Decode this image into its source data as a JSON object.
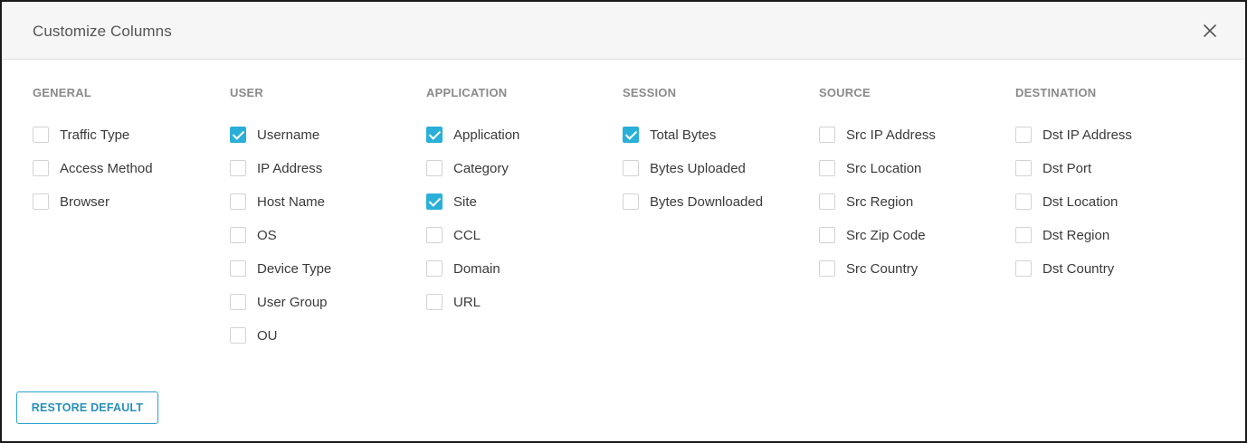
{
  "dialog": {
    "title": "Customize Columns",
    "close_icon": "close-icon"
  },
  "accent_color": "#2ab0d8",
  "groups": [
    {
      "id": "general",
      "heading": "GENERAL",
      "options": [
        {
          "label": "Traffic Type",
          "checked": false
        },
        {
          "label": "Access Method",
          "checked": false
        },
        {
          "label": "Browser",
          "checked": false
        }
      ]
    },
    {
      "id": "user",
      "heading": "USER",
      "options": [
        {
          "label": "Username",
          "checked": true
        },
        {
          "label": "IP Address",
          "checked": false
        },
        {
          "label": "Host Name",
          "checked": false
        },
        {
          "label": "OS",
          "checked": false
        },
        {
          "label": "Device Type",
          "checked": false
        },
        {
          "label": "User Group",
          "checked": false
        },
        {
          "label": "OU",
          "checked": false
        }
      ]
    },
    {
      "id": "application",
      "heading": "APPLICATION",
      "options": [
        {
          "label": "Application",
          "checked": true
        },
        {
          "label": "Category",
          "checked": false
        },
        {
          "label": "Site",
          "checked": true
        },
        {
          "label": "CCL",
          "checked": false
        },
        {
          "label": "Domain",
          "checked": false
        },
        {
          "label": "URL",
          "checked": false
        }
      ]
    },
    {
      "id": "session",
      "heading": "SESSION",
      "options": [
        {
          "label": "Total Bytes",
          "checked": true
        },
        {
          "label": "Bytes Uploaded",
          "checked": false
        },
        {
          "label": "Bytes Downloaded",
          "checked": false
        }
      ]
    },
    {
      "id": "source",
      "heading": "SOURCE",
      "options": [
        {
          "label": "Src IP Address",
          "checked": false
        },
        {
          "label": "Src Location",
          "checked": false
        },
        {
          "label": "Src Region",
          "checked": false
        },
        {
          "label": "Src Zip Code",
          "checked": false
        },
        {
          "label": "Src Country",
          "checked": false
        }
      ]
    },
    {
      "id": "destination",
      "heading": "DESTINATION",
      "options": [
        {
          "label": "Dst IP Address",
          "checked": false
        },
        {
          "label": "Dst Port",
          "checked": false
        },
        {
          "label": "Dst Location",
          "checked": false
        },
        {
          "label": "Dst Region",
          "checked": false
        },
        {
          "label": "Dst Country",
          "checked": false
        }
      ]
    }
  ],
  "footer": {
    "restore_label": "RESTORE DEFAULT"
  }
}
